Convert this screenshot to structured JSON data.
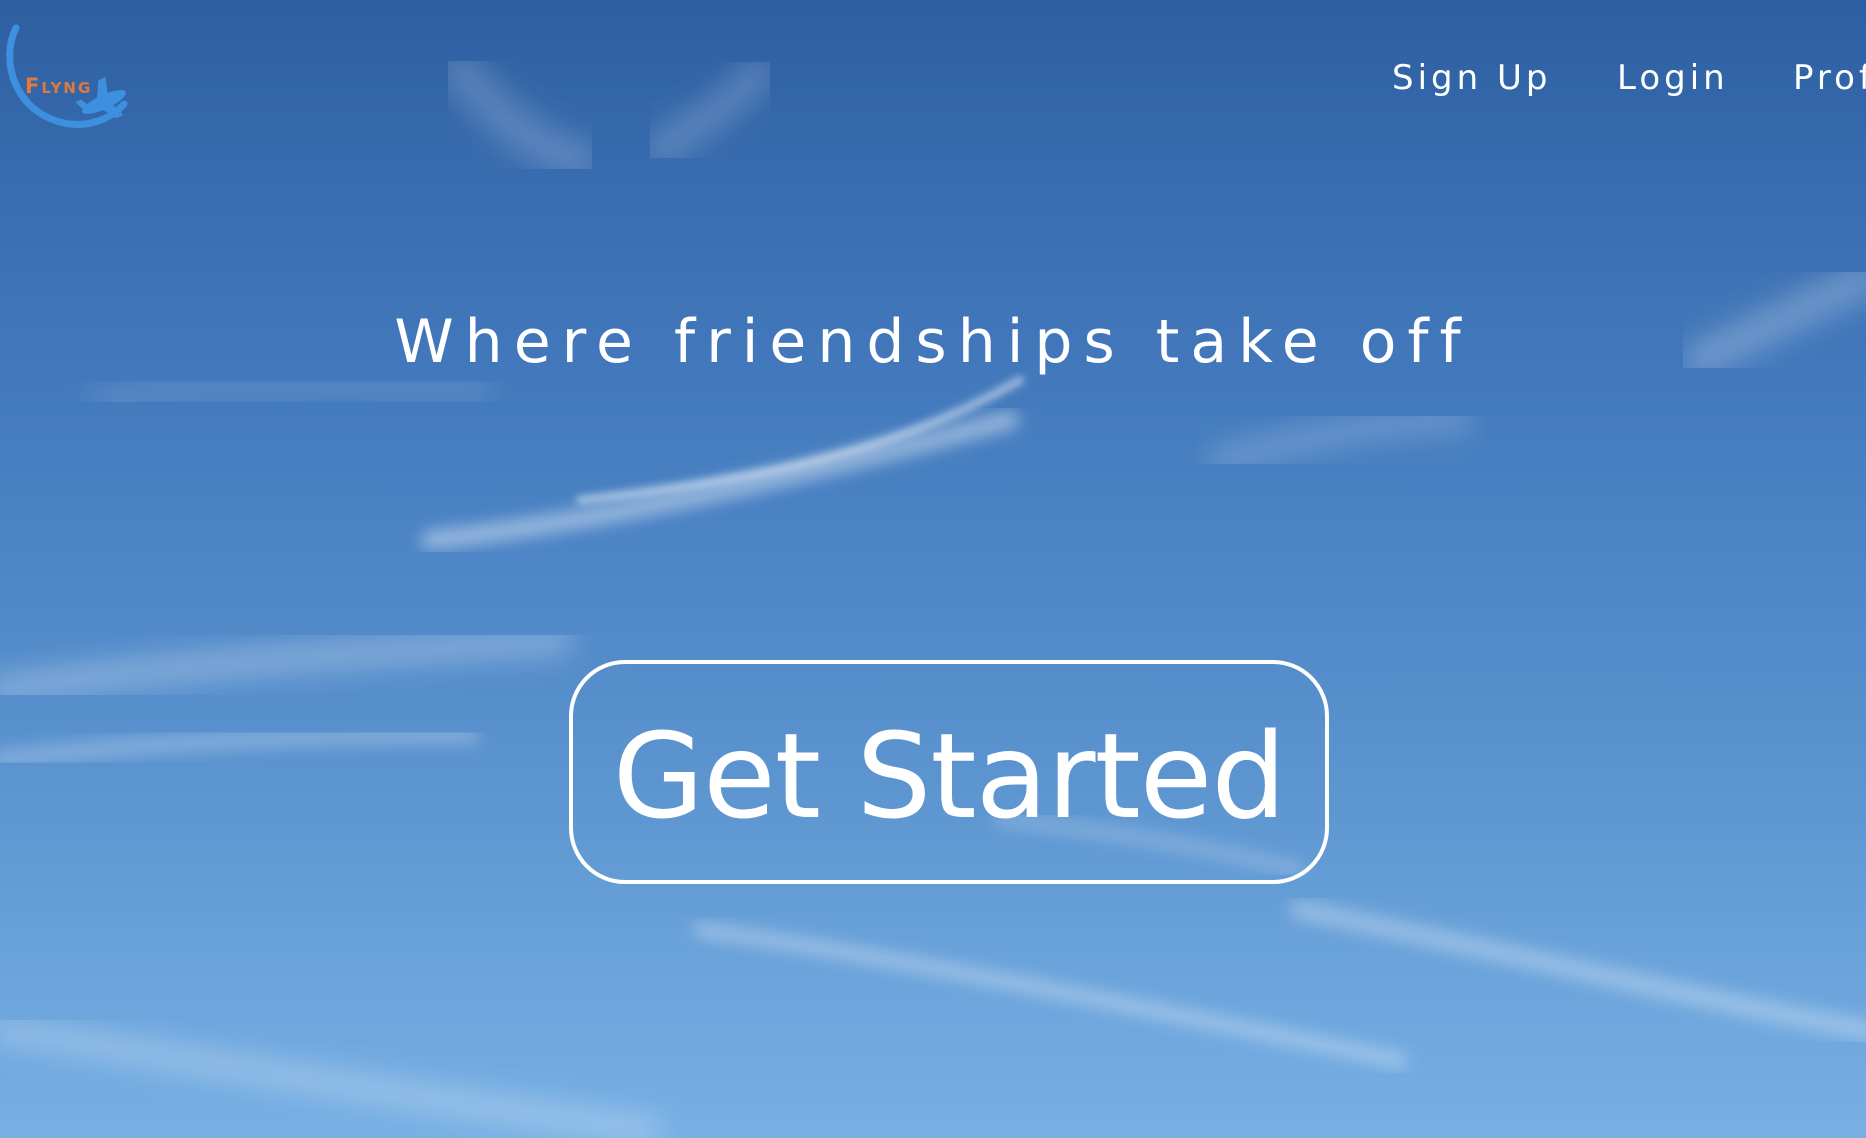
{
  "logo": {
    "text": "Flyng",
    "icon": "airplane-orbit-icon",
    "text_color": "#e0793a",
    "icon_color": "#3d8fe0"
  },
  "nav": {
    "items": [
      {
        "label": "Sign Up"
      },
      {
        "label": "Login"
      },
      {
        "label": "Profile"
      }
    ]
  },
  "hero": {
    "headline": "Where friendships take off",
    "cta_label": "Get Started"
  },
  "colors": {
    "text": "#ffffff",
    "sky_top": "#2d5fa0",
    "sky_bottom": "#78b0e4"
  }
}
